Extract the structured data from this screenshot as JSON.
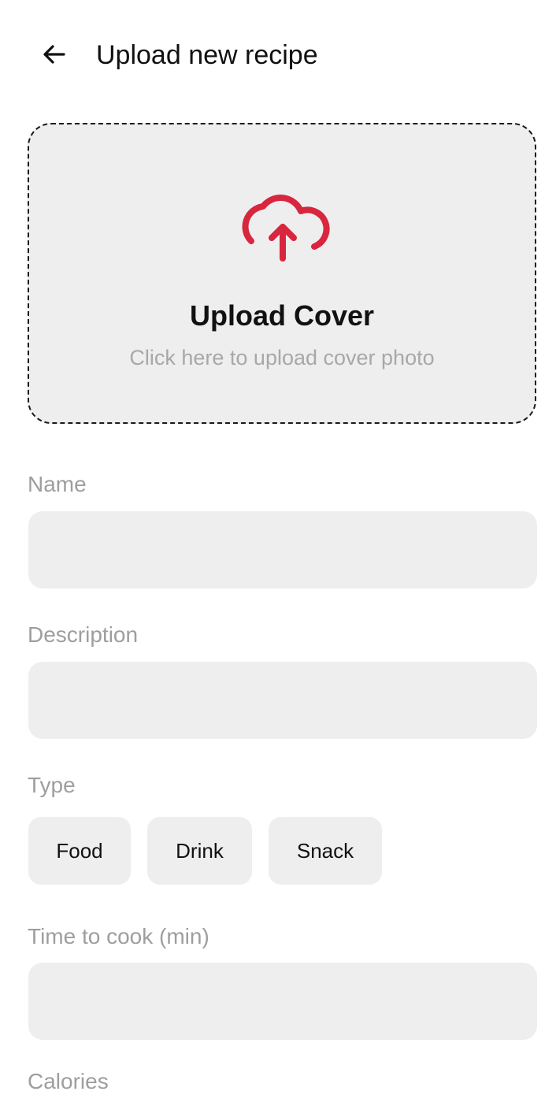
{
  "header": {
    "back_icon": "arrow-left-icon",
    "title": "Upload new recipe"
  },
  "upload": {
    "icon": "cloud-upload-icon",
    "icon_color": "#d7263d",
    "title": "Upload Cover",
    "subtitle": "Click here to upload cover photo"
  },
  "form": {
    "name_label": "Name",
    "name_value": "",
    "description_label": "Description",
    "description_value": "",
    "type_label": "Type",
    "type_options": [
      "Food",
      "Drink",
      "Snack"
    ],
    "time_label": "Time to cook (min)",
    "time_value": "",
    "calories_label": "Calories"
  }
}
